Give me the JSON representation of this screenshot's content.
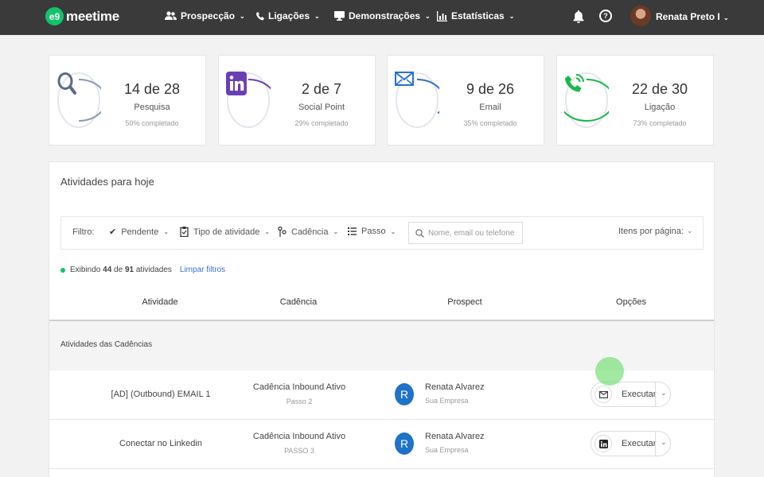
{
  "brand": {
    "logo_mark": "e9",
    "name": "meetime",
    "color": "#13c26b"
  },
  "nav": {
    "items": [
      {
        "label": "Prospecção",
        "icon": "users-icon"
      },
      {
        "label": "Ligações",
        "icon": "phone-icon"
      },
      {
        "label": "Demonstrações",
        "icon": "monitor-icon"
      },
      {
        "label": "Estatísticas",
        "icon": "bar-chart-icon"
      }
    ],
    "help_glyph": "?",
    "user_name": "Renata Preto I"
  },
  "stats": [
    {
      "main": "14 de 28",
      "label": "Pesquisa",
      "sub": "50% completado",
      "progress": 0.5,
      "color": "#8a98b0",
      "icon": "search-icon"
    },
    {
      "main": "2 de 7",
      "label": "Social Point",
      "sub": "29% completado",
      "progress": 0.29,
      "color": "#6a3fb5",
      "icon": "linkedin-icon"
    },
    {
      "main": "9 de 26",
      "label": "Email",
      "sub": "35% completado",
      "progress": 0.35,
      "color": "#2a6fd0",
      "icon": "email-icon"
    },
    {
      "main": "22 de 30",
      "label": "Ligação",
      "sub": "73% completado",
      "progress": 0.73,
      "color": "#19b84c",
      "icon": "phone-call-icon"
    }
  ],
  "activities": {
    "title": "Atividades para hoje",
    "filters": {
      "label": "Filtro:",
      "pending": "Pendente",
      "activity_type": "Tipo de atividade",
      "cadence": "Cadência",
      "step": "Passo",
      "search_placeholder": "Nome, email ou telefone",
      "per_page": "Itens por página:"
    },
    "count": {
      "prefix": "Exibindo",
      "shown": "44",
      "of": "de",
      "total": "91",
      "suffix": "atividades",
      "clear": "Limpar filtros"
    },
    "columns": [
      "Atividade",
      "Cadência",
      "Prospect",
      "Opções"
    ],
    "group_title": "Atividades das Cadências",
    "rows": [
      {
        "activity": "[AD] (Outbound) EMAIL 1",
        "cadence": "Cadência Inbound Ativo",
        "step": "Passo 2",
        "initial": "R",
        "prospect": "Renata Alvarez",
        "company": "Sua Empresa",
        "action": "Executar",
        "action_icon": "email-icon"
      },
      {
        "activity": "Conectar no Linkedin",
        "cadence": "Cadência Inbound Ativo",
        "step": "PASSO 3",
        "initial": "R",
        "prospect": "Renata Alvarez",
        "company": "Sua Empresa",
        "action": "Executar",
        "action_icon": "linkedin-icon"
      }
    ]
  }
}
